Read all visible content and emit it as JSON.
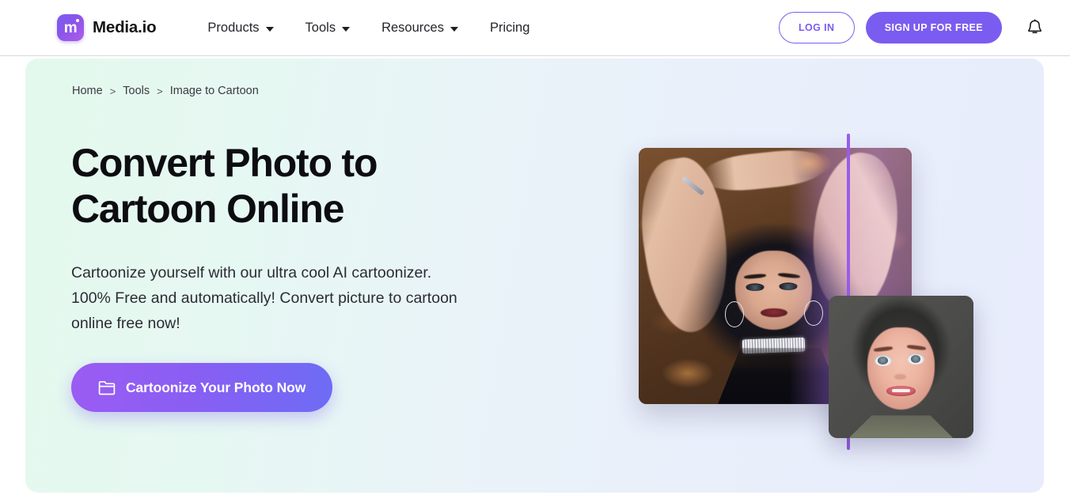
{
  "header": {
    "logo_icon": "media-io-logo-icon",
    "brand_name": "Media.io",
    "nav": [
      {
        "label": "Products",
        "has_dropdown": true
      },
      {
        "label": "Tools",
        "has_dropdown": true
      },
      {
        "label": "Resources",
        "has_dropdown": true
      },
      {
        "label": "Pricing",
        "has_dropdown": false
      }
    ],
    "login_label": "LOG IN",
    "signup_label": "SIGN UP FOR FREE",
    "bell_icon": "notification-bell-icon",
    "accent_color": "#7b5cf0"
  },
  "breadcrumb": {
    "items": [
      "Home",
      "Tools",
      "Image to Cartoon"
    ],
    "separator": ">"
  },
  "hero": {
    "title_line1": "Convert Photo to",
    "title_line2": "Cartoon Online",
    "subtitle_line1": "Cartoonize yourself with our ultra cool AI cartoonizer.",
    "subtitle_line2": "100% Free and automatically! Convert picture to cartoon",
    "subtitle_line3": "online free now!",
    "cta_label": "Cartoonize Your Photo Now",
    "cta_icon": "folder-open-icon",
    "cta_gradient_start": "#9b5cf3",
    "cta_gradient_end": "#6d6cf5",
    "background_gradient_start": "#e4f9ed",
    "background_gradient_end": "#e8ecfc",
    "preview": {
      "before_image_alt": "woman lying on autumn leaves original photo",
      "after_image_alt": "cartoonized portrait result",
      "divider_color": "#9a5ce8"
    }
  }
}
